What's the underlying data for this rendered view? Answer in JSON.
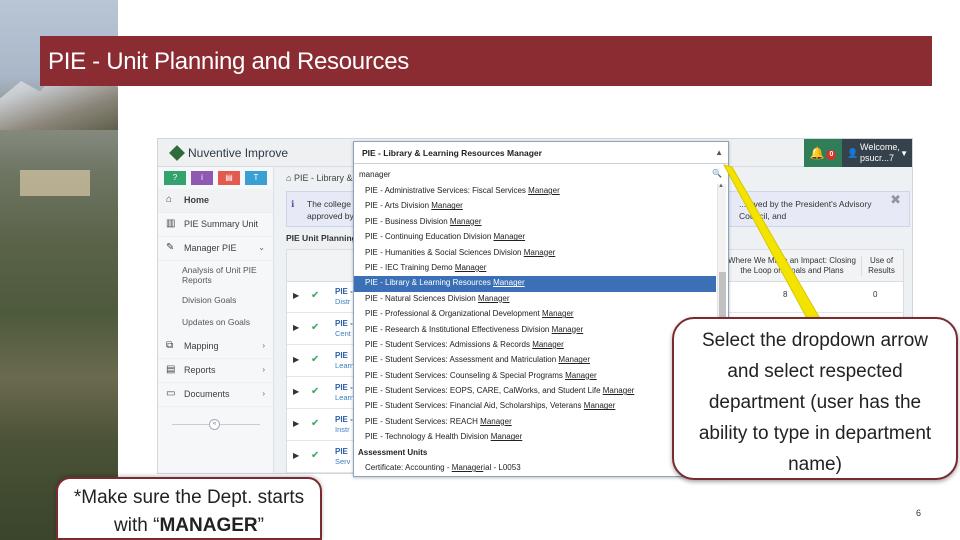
{
  "slide": {
    "title": "PIE - Unit Planning and Resources",
    "page_number": "6",
    "colors": {
      "title_bar": "#8b2b32",
      "callout_border": "#7a2b30",
      "pointer": "#f2e400",
      "selected_option": "#3b6fb6"
    }
  },
  "app": {
    "logo_text": "Nuventive Improve",
    "notification_count": "0",
    "user_welcome": "Welcome,",
    "user_name": "psucr...7",
    "breadcrumb": "PIE - Library &",
    "notice_text_left": "The college is u...",
    "notice_text_left2": "approved by the",
    "notice_text_right": "...roved by the President's Advisory Council, and",
    "section_title": "PIE Unit Planning",
    "sidebar": {
      "tools": [
        "?",
        "i",
        "▤",
        "T"
      ],
      "home": "Home",
      "pie_summary": "PIE Summary Unit",
      "manager_pie": "Manager PIE",
      "sub_items": [
        "Analysis of Unit PIE Reports",
        "Division Goals",
        "Updates on Goals"
      ],
      "mapping": "Mapping",
      "reports": "Reports",
      "documents": "Documents"
    },
    "grid": {
      "col_impact": "Where We Make an Impact: Closing the Loop on Goals and Plans",
      "col_results": "Use of Results",
      "rows": [
        {
          "name": "PIE -",
          "sub": "Distr",
          "impact": "8",
          "results": "0"
        },
        {
          "name": "PIE -",
          "sub": "Cent",
          "impact": "",
          "results": ""
        },
        {
          "name": "PIE",
          "sub": "Learn",
          "impact": "",
          "results": ""
        },
        {
          "name": "PIE -",
          "sub": "Learn",
          "impact": "",
          "results": ""
        },
        {
          "name": "PIE -",
          "sub": "Instr",
          "impact": "",
          "results": ""
        },
        {
          "name": "PIE",
          "sub": "Serv",
          "impact": "",
          "results": ""
        }
      ]
    }
  },
  "dropdown": {
    "selected": "PIE - Library & Learning Resources Manager",
    "search_value": "manager",
    "options": [
      {
        "text": "PIE - Administrative Services: Fiscal Services Manager",
        "selected": false,
        "group": false
      },
      {
        "text": "PIE - Arts Division Manager",
        "selected": false,
        "group": false
      },
      {
        "text": "PIE - Business Division Manager",
        "selected": false,
        "group": false
      },
      {
        "text": "PIE - Continuing Education Division Manager",
        "selected": false,
        "group": false
      },
      {
        "text": "PIE - Humanities & Social Sciences Division Manager",
        "selected": false,
        "group": false
      },
      {
        "text": "PIE - IEC Training Demo Manager",
        "selected": false,
        "group": false
      },
      {
        "text": "PIE - Library & Learning Resources Manager",
        "selected": true,
        "group": false
      },
      {
        "text": "PIE - Natural Sciences Division Manager",
        "selected": false,
        "group": false
      },
      {
        "text": "PIE - Professional & Organizational Development Manager",
        "selected": false,
        "group": false
      },
      {
        "text": "PIE - Research & Institutional Effectiveness Division Manager",
        "selected": false,
        "group": false
      },
      {
        "text": "PIE - Student Services: Admissions & Records Manager",
        "selected": false,
        "group": false
      },
      {
        "text": "PIE - Student Services: Assessment and Matriculation Manager",
        "selected": false,
        "group": false
      },
      {
        "text": "PIE - Student Services: Counseling & Special Programs Manager",
        "selected": false,
        "group": false
      },
      {
        "text": "PIE - Student Services: EOPS, CARE, CalWorks, and Student Life Manager",
        "selected": false,
        "group": false
      },
      {
        "text": "PIE - Student Services: Financial Aid, Scholarships, Veterans Manager",
        "selected": false,
        "group": false
      },
      {
        "text": "PIE - Student Services: REACH Manager",
        "selected": false,
        "group": false
      },
      {
        "text": "PIE - Technology & Health Division Manager",
        "selected": false,
        "group": false
      },
      {
        "text": "Assessment Units",
        "selected": false,
        "group": true
      },
      {
        "text": "Certificate: Accounting - Managerial - L0053",
        "selected": false,
        "group": false
      }
    ]
  },
  "callout": {
    "text": "Select the dropdown arrow and select respected department (user has the ability to type in department name)"
  },
  "note": {
    "prefix": "*Make sure the Dept. starts with “",
    "bold": "MANAGER",
    "suffix": "”"
  }
}
